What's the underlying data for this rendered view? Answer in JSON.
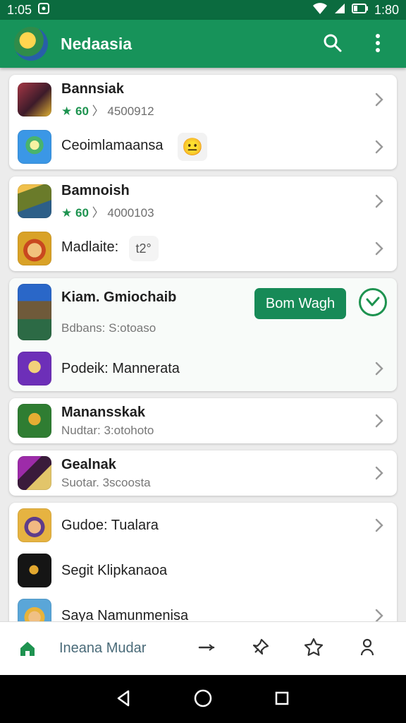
{
  "status_bar": {
    "time_left": "1:05",
    "time_right": "1:80",
    "icons": [
      "notification-icon",
      "wifi-icon",
      "signal-icon",
      "battery-icon"
    ]
  },
  "appbar": {
    "title": "Nedaasia",
    "icons": [
      "search-icon",
      "more-vert-icon"
    ]
  },
  "cards": [
    {
      "rows": [
        {
          "title": "Bannsiak",
          "score": "60",
          "meta": "〉 4500912",
          "thumb_color": "#8f2b37"
        },
        {
          "single": "Ceoimlamaansa",
          "emoji": "😐",
          "thumb_color": "#3b97e6"
        }
      ]
    },
    {
      "rows": [
        {
          "title": "Bamnoish",
          "score": "60",
          "meta": "〉 4000103",
          "thumb_color": "#6a7b2a"
        },
        {
          "single": "Madlaite:",
          "badge": "t2°",
          "thumb_color": "#d9a227"
        }
      ]
    },
    {
      "active": true,
      "rows": [
        {
          "title": "Kiam. Gmiochaib",
          "subtitle": "Bdbans: S:otoaso",
          "button": "Bom Wagh",
          "thumb_color": "#2457a8"
        },
        {
          "single": "Podeik: Mannerata",
          "thumb_color": "#5e2ca5"
        }
      ]
    },
    {
      "rows": [
        {
          "title": "Manansskak",
          "subtitle": "Nudtar: 3:otohoto",
          "thumb_color": "#2f7d32"
        }
      ]
    },
    {
      "rows": [
        {
          "title": "Gealnak",
          "subtitle": "Suotar. 3scoosta",
          "thumb_color": "#9d2ba9"
        }
      ]
    },
    {
      "rows": [
        {
          "single": "Gudoe: Tualara",
          "thumb_color": "#e6b341"
        },
        {
          "single": "Segit Klipkanaoa",
          "thumb_color": "#151515"
        },
        {
          "single": "Saya Namunmenisa",
          "thumb_color": "#5aa6d8"
        }
      ]
    }
  ],
  "bottom_nav": {
    "label": "Ineana Mudar",
    "icons": [
      "home-icon",
      "minus-icon",
      "pin-icon",
      "star-icon",
      "person-icon"
    ]
  },
  "system_nav": [
    "back-icon",
    "home-circle-icon",
    "recents-icon"
  ]
}
